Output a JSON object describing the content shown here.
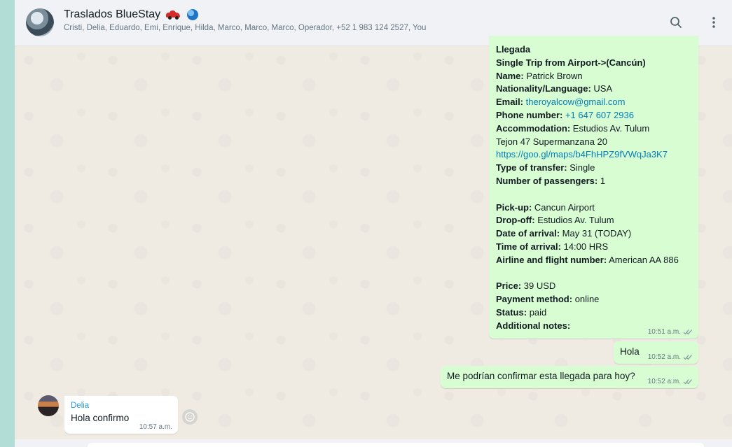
{
  "header": {
    "group_name": "Traslados BlueStay",
    "participants": "Cristi, Delia, Eduardo, Emi, Enrique, Hilda, Marco, Marco, Marco, Operador, +52 1 983 124 2527, You",
    "icons": [
      "car-icon",
      "globe-icon",
      "search-icon",
      "menu-dots-icon"
    ]
  },
  "messages": {
    "booking": {
      "title": "Llegada",
      "subtitle": "Single Trip from Airport->(Cancún)",
      "name_label": "Name:",
      "name_value": "Patrick Brown",
      "nationality_label": "Nationality/Language:",
      "nationality_value": "USA",
      "email_label": "Email:",
      "email_value": "theroyalcow@gmail.com",
      "phone_label": "Phone number:",
      "phone_value": "+1 647 607 2936",
      "accommodation_label": "Accommodation:",
      "accommodation_value": "Estudios Av. Tulum",
      "address": "Tejon 47 Supermanzana 20",
      "maps_link": "https://goo.gl/maps/b4FhHPZ9fVWqJa3K7",
      "transfer_label": "Type of transfer:",
      "transfer_value": "Single",
      "passengers_label": "Number of passengers:",
      "passengers_value": "1",
      "pickup_label": "Pick-up:",
      "pickup_value": "Cancun Airport",
      "dropoff_label": "Drop-off:",
      "dropoff_value": "Estudios Av. Tulum",
      "date_label": "Date of arrival:",
      "date_value": "May 31 (TODAY)",
      "time_label": "Time of arrival:",
      "time_value": "14:00 HRS",
      "airline_label": "Airline and flight number:",
      "airline_value": "American AA 886",
      "price_label": "Price:",
      "price_value": "39 USD",
      "payment_label": "Payment method:",
      "payment_value": "online",
      "status_label": "Status:",
      "status_value": "paid",
      "notes_label": "Additional notes:",
      "time": "10:51 a.m."
    },
    "hola": {
      "text": "Hola",
      "time": "10:52 a.m."
    },
    "question": {
      "text": "Me podrían confirmar esta llegada para hoy?",
      "time": "10:52 a.m."
    },
    "reply": {
      "sender": "Delia",
      "text": "Hola confirmo",
      "time": "10:57 a.m."
    }
  },
  "colors": {
    "outgoing_bubble": "#d9fdd3",
    "incoming_bubble": "#ffffff",
    "link": "#027eb5",
    "read_ticks": "#53bdeb"
  }
}
